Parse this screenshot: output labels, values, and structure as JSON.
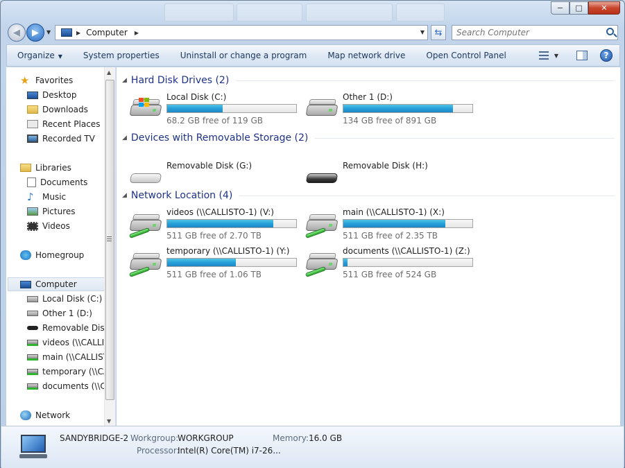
{
  "window": {
    "caption_buttons": {
      "minimize": "−",
      "maximize": "□",
      "close": "✕"
    }
  },
  "address_bar": {
    "breadcrumb": "Computer",
    "search_placeholder": "Search Computer"
  },
  "toolbar": {
    "commands": [
      {
        "label": "Organize",
        "has_dropdown": true
      },
      {
        "label": "System properties"
      },
      {
        "label": "Uninstall or change a program"
      },
      {
        "label": "Map network drive"
      },
      {
        "label": "Open Control Panel"
      }
    ],
    "help": "?"
  },
  "nav_pane": {
    "favorites": {
      "label": "Favorites",
      "items": [
        "Desktop",
        "Downloads",
        "Recent Places",
        "Recorded TV"
      ]
    },
    "libraries": {
      "label": "Libraries",
      "items": [
        "Documents",
        "Music",
        "Pictures",
        "Videos"
      ]
    },
    "homegroup": {
      "label": "Homegroup"
    },
    "computer": {
      "label": "Computer",
      "items": [
        "Local Disk (C:)",
        "Other 1 (D:)",
        "Removable Disk (",
        "videos (\\\\CALLIST",
        "main (\\\\CALLIST",
        "temporary (\\\\CA",
        "documents (\\\\CA"
      ]
    },
    "network": {
      "label": "Network"
    }
  },
  "content": {
    "groups": [
      {
        "title": "Hard Disk Drives (2)",
        "drives": [
          {
            "name": "Local Disk (C:)",
            "free_text": "68.2 GB free of 119 GB",
            "used_fraction": 0.43,
            "icon": "windows-hdd-icon"
          },
          {
            "name": "Other 1 (D:)",
            "free_text": "134 GB free of 891 GB",
            "used_fraction": 0.85,
            "icon": "hdd-icon"
          }
        ]
      },
      {
        "title": "Devices with Removable Storage (2)",
        "drives": [
          {
            "name": "Removable Disk (G:)",
            "icon": "removable-disk-icon"
          },
          {
            "name": "Removable Disk (H:)",
            "icon": "removable-disk-dark-icon"
          }
        ]
      },
      {
        "title": "Network Location (4)",
        "drives": [
          {
            "name": "videos (\\\\CALLISTO-1) (V:)",
            "free_text": "511 GB free of 2.70 TB",
            "used_fraction": 0.82,
            "icon": "network-drive-icon"
          },
          {
            "name": "main (\\\\CALLISTO-1) (X:)",
            "free_text": "511 GB free of 2.35 TB",
            "used_fraction": 0.79,
            "icon": "network-drive-icon"
          },
          {
            "name": "temporary (\\\\CALLISTO-1) (Y:)",
            "free_text": "511 GB free of 1.06 TB",
            "used_fraction": 0.53,
            "icon": "network-drive-icon"
          },
          {
            "name": "documents (\\\\CALLISTO-1) (Z:)",
            "free_text": "511 GB free of 524 GB",
            "used_fraction": 0.03,
            "icon": "network-drive-icon"
          }
        ]
      }
    ]
  },
  "details_pane": {
    "computer_name": "SANDYBRIDGE-2",
    "workgroup_label": "Workgroup:",
    "workgroup_value": "WORKGROUP",
    "memory_label": "Memory:",
    "memory_value": "16.0 GB",
    "processor_label": "Processor:",
    "processor_value": "Intel(R) Core(TM) i7-26..."
  },
  "colors": {
    "group_title": "#1e3287",
    "bar_fill": "#26a0da",
    "command_text": "#1e395b"
  }
}
